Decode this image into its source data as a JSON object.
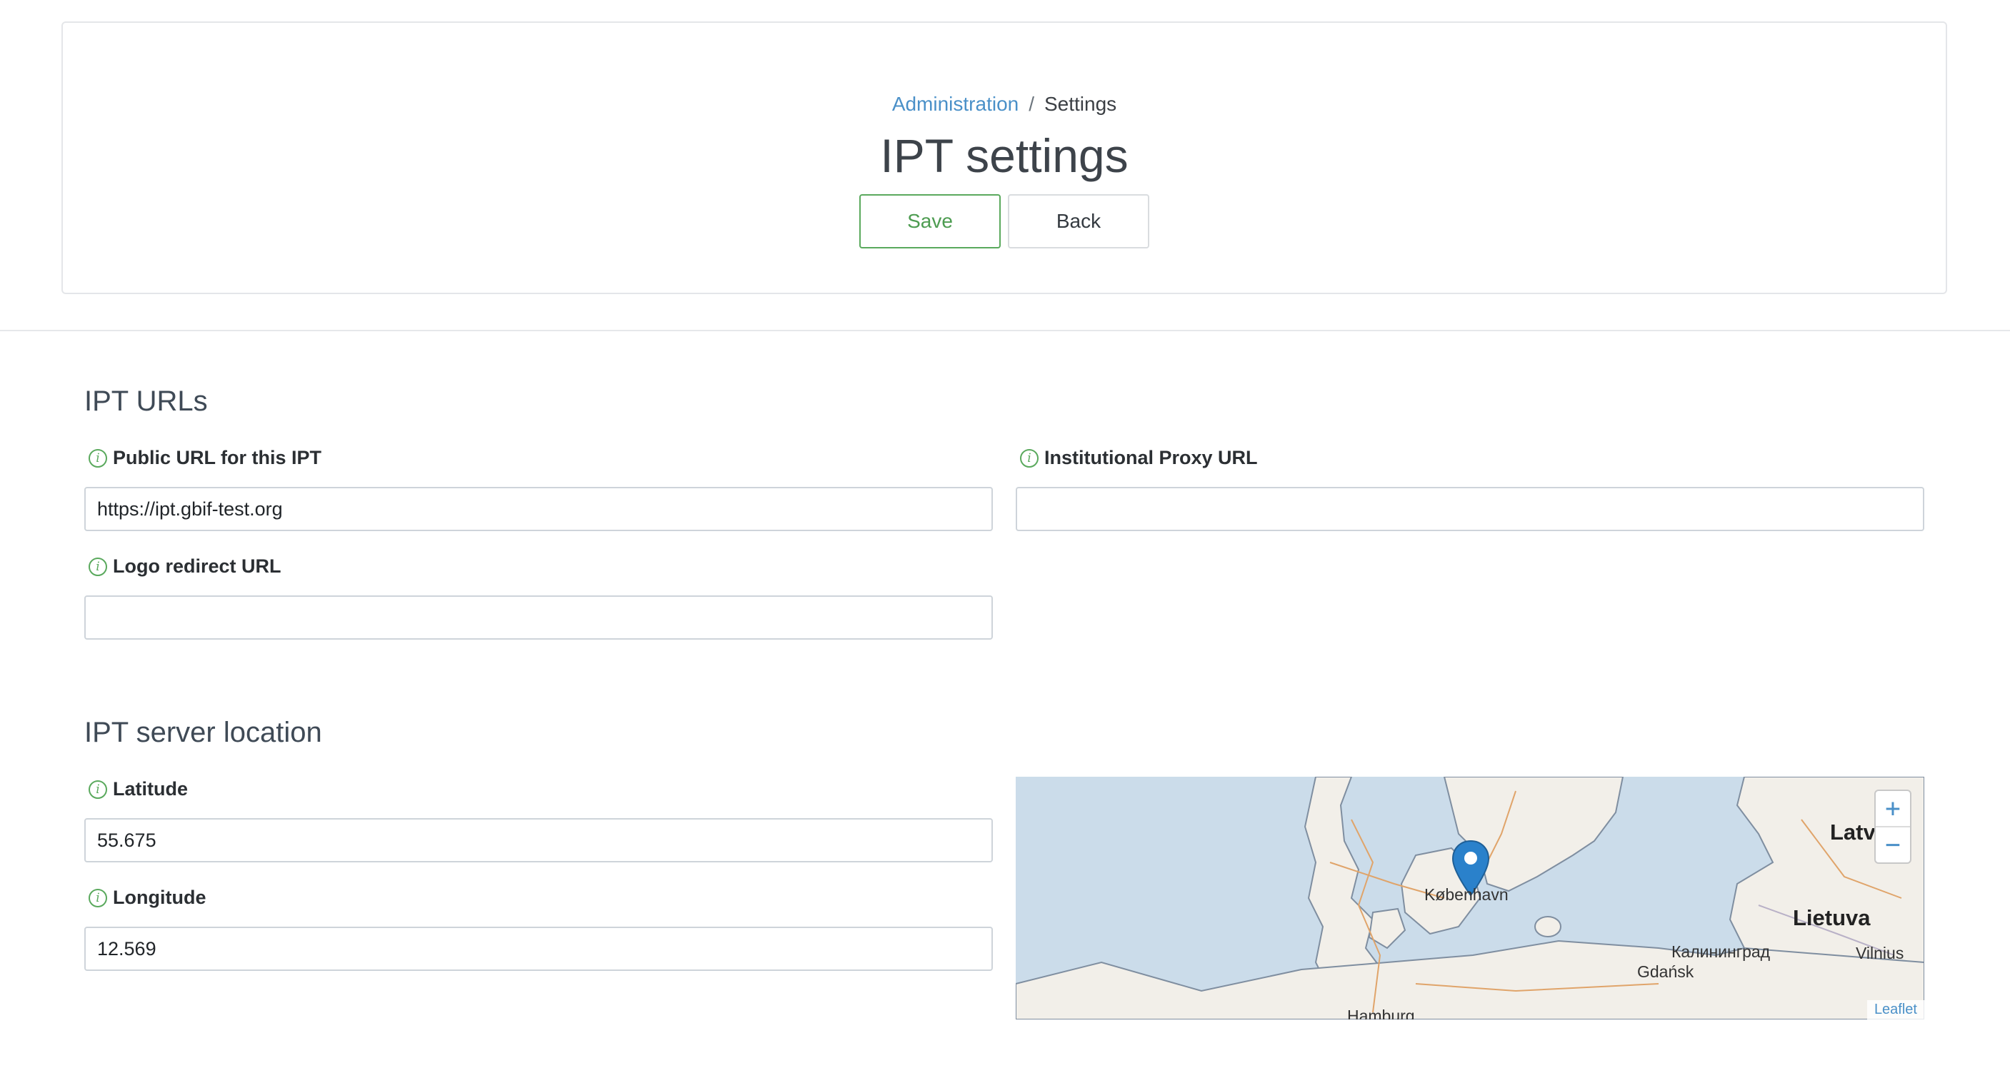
{
  "breadcrumb": {
    "parent": "Administration",
    "separator": "/",
    "current": "Settings"
  },
  "page": {
    "title": "IPT settings"
  },
  "actions": {
    "save_label": "Save",
    "back_label": "Back"
  },
  "sections": {
    "urls": {
      "title": "IPT URLs",
      "public_url": {
        "label": "Public URL for this IPT",
        "value": "https://ipt.gbif-test.org"
      },
      "proxy_url": {
        "label": "Institutional Proxy URL",
        "value": ""
      },
      "logo_url": {
        "label": "Logo redirect URL",
        "value": ""
      }
    },
    "location": {
      "title": "IPT server location",
      "latitude": {
        "label": "Latitude",
        "value": "55.675"
      },
      "longitude": {
        "label": "Longitude",
        "value": "12.569"
      }
    }
  },
  "map": {
    "zoom_in": "+",
    "zoom_out": "−",
    "attribution": "Leaflet",
    "places": {
      "copenhagen": "København",
      "latvia": "Latv",
      "lithuania": "Lietuva",
      "kaliningrad": "Калининград",
      "gdansk": "Gdańsk",
      "vilnius": "Vilnius",
      "hamburg": "Hamburg"
    }
  },
  "icons": {
    "info": "info-circle-icon",
    "marker": "map-marker-icon"
  },
  "colors": {
    "accent": "#5aa95d",
    "link": "#4a90c8",
    "water": "#cbdcea",
    "land": "#f2efe9"
  }
}
